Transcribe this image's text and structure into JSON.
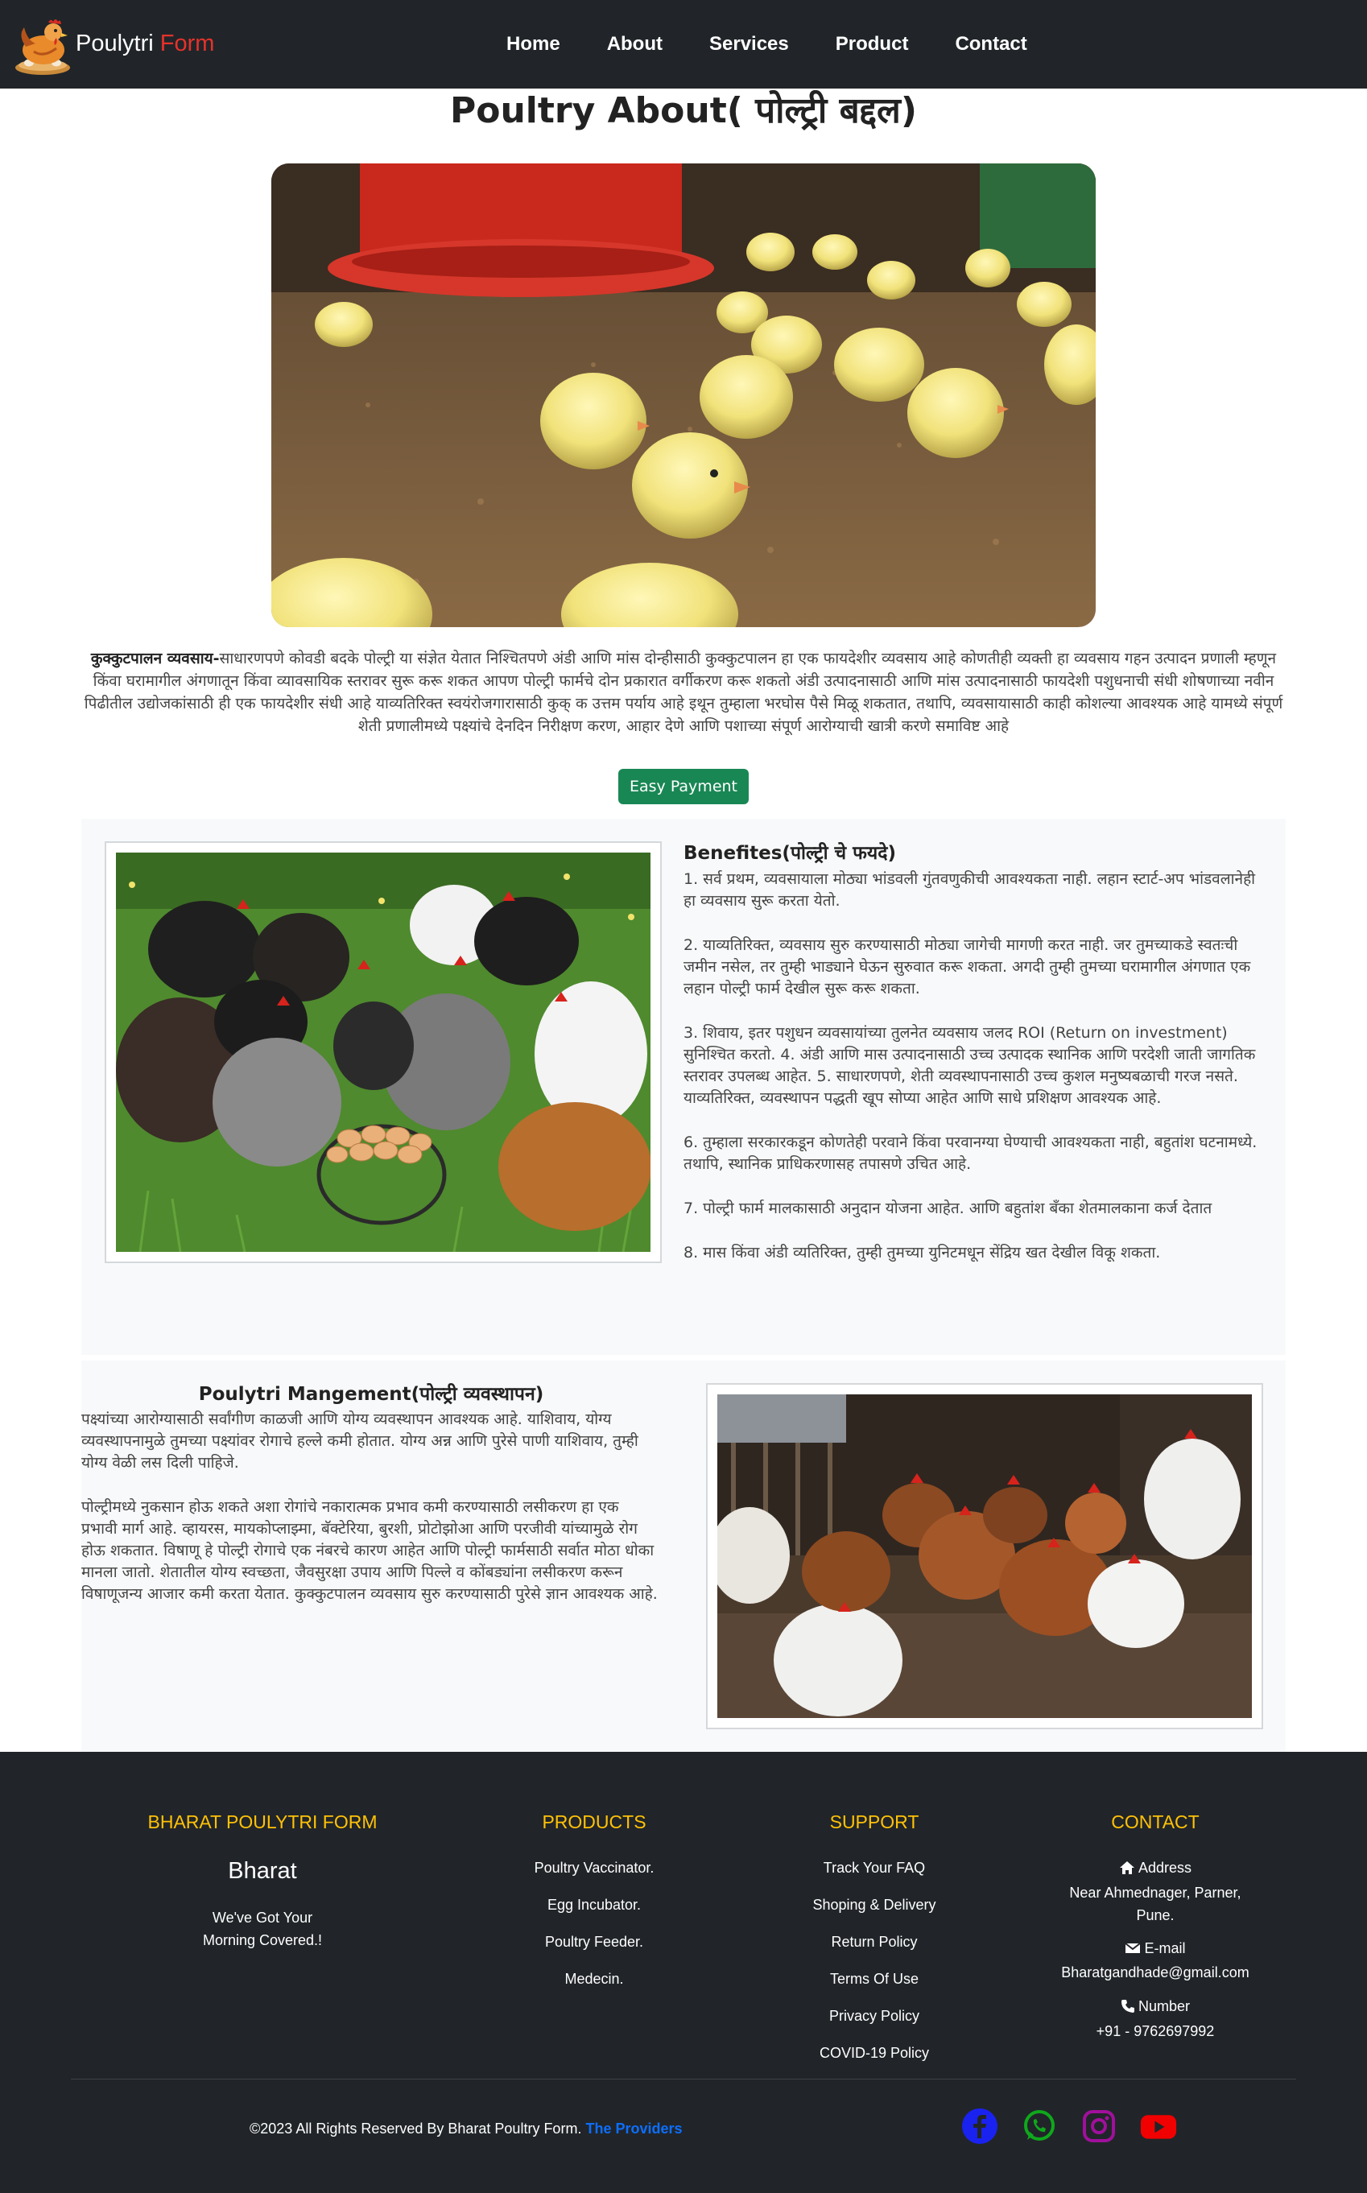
{
  "brand": {
    "name": "Poulytri",
    "accent": "Form"
  },
  "nav": {
    "items": [
      "Home",
      "About",
      "Services",
      "Product",
      "Contact"
    ]
  },
  "about": {
    "title": "Poultry About( पोल्ट्री बद्दल)",
    "lead": "कुक्कुटपालन व्यवसाय-",
    "text": "साधारणपणे कोवडी बदके पोल्ट्री या संज्ञेत येतात निश्चितपणे अंडी आणि मांस दोन्हीसाठी कुक्कुटपालन हा एक फायदेशीर व्यवसाय आहे कोणतीही व्यक्ती हा व्यवसाय गहन उत्पादन प्रणाली म्हणून किंवा घरामागील अंगणातून किंवा व्यावसायिक स्तरावर सुरू करू शकत आपण पोल्ट्री फार्मचे दोन प्रकारात वर्गीकरण करू शकतो अंडी उत्पादनासाठी आणि मांस उत्पादनासाठी फायदेशी पशुधनाची संधी शोषणाच्या नवीन पिढीतील उद्योजकांसाठी ही एक फायदेशीर संधी आहे याव्यतिरिक्त स्वयंरोजगारासाठी कुक्‌ क उत्तम पर्याय आहे इथून तुम्हाला भरघोस पैसे मिळू शकतात, तथापि, व्यवसायासाठी काही कोशल्या आवश्यक आहे यामध्ये संपूर्ण शेती प्रणालीमध्ये पक्ष्यांचे देनदिन निरीक्षण करण, आहार देणे आणि पशाच्या संपूर्ण आरोग्याची खात्री करणे समाविष्ट आहे",
    "pay_button": "Easy Payment"
  },
  "benefits": {
    "title": "Benefites(पोल्ट्री चे फयदे)",
    "items": [
      "1. सर्व प्रथम, व्यवसायाला मोठ्या भांडवली गुंतवणुकीची आवश्यकता नाही. लहान स्टार्ट-अप भांडवलानेही हा व्यवसाय सुरू करता येतो.",
      "2. याव्यतिरिक्त, व्यवसाय सुरु करण्यासाठी मोठ्या जागेची मागणी करत नाही. जर तुमच्याकडे स्वतःची जमीन नसेल, तर तुम्ही भाड्याने घेऊन सुरुवात करू शकता. अगदी तुम्ही तुमच्या घरामागील अंगणात एक लहान पोल्ट्री फार्म देखील सुरू करू शकता.",
      "3. शिवाय, इतर पशुधन व्यवसायांच्या तुलनेत व्यवसाय जलद ROI (Return on investment) सुनिश्चित करतो. 4. अंडी आणि मास उत्पादनासाठी उच्च उत्पादक स्थानिक आणि परदेशी जाती जागतिक स्तरावर उपलब्ध आहेत. 5. साधारणपणे, शेती व्यवस्थापनासाठी उच्च कुशल मनुष्यबळाची गरज नसते. याव्यतिरिक्त, व्यवस्थापन पद्धती खूप सोप्या आहेत आणि साधे प्रशिक्षण आवश्यक आहे.",
      "6. तुम्हाला सरकारकडून कोणतेही परवाने किंवा परवानग्या घेण्याची आवश्यकता नाही, बहुतांश घटनामध्ये. तथापि, स्थानिक प्राधिकरणासह तपासणे उचित आहे.",
      "7. पोल्ट्री फार्म मालकासाठी अनुदान योजना आहेत. आणि बहुतांश बँका शेतमालकाना कर्ज देतात",
      "8. मास किंवा अंडी व्यतिरिक्त, तुम्ही तुमच्या युनिटमधून सेंद्रिय खत देखील विकू शकता."
    ]
  },
  "management": {
    "title": "Poulytri Mangement(पोल्ट्री व्यवस्थापन)",
    "paragraphs": [
      "पक्ष्यांच्या आरोग्यासाठी सर्वांगीण काळजी आणि योग्य व्यवस्थापन आवश्यक आहे. याशिवाय, योग्य व्यवस्थापनामुळे तुमच्या पक्ष्यांवर रोगाचे हल्ले कमी होतात. योग्य अन्न आणि पुरेसे पाणी याशिवाय, तुम्ही योग्य वेळी लस दिली पाहिजे.",
      "पोल्ट्रीमध्ये नुकसान होऊ शकते अशा रोगांचे नकारात्मक प्रभाव कमी करण्यासाठी लसीकरण हा एक प्रभावी मार्ग आहे. व्हायरस, मायकोप्लाझ्मा, बॅक्टेरिया, बुरशी, प्रोटोझोआ आणि परजीवी यांच्यामुळे रोग होऊ शकतात. विषाणू हे पोल्ट्री रोगाचे एक नंबरचे कारण आहेत आणि पोल्ट्री फार्मसाठी सर्वात मोठा धोका मानला जातो. शेतातील योग्य स्वच्छता, जैवसुरक्षा उपाय आणि पिल्ले व कोंबड्यांना लसीकरण करून विषाणूजन्य आजार कमी करता येतात. कुक्कुटपालन व्यवसाय सुरु करण्यासाठी पुरेसे ज्ञान आवश्यक आहे."
    ]
  },
  "footer": {
    "about_col": {
      "heading": "BHARAT POULYTRI FORM",
      "name": "Bharat",
      "tagline_1": "We've Got Your",
      "tagline_2": "Morning Covered.!"
    },
    "products": {
      "heading": "PRODUCTS",
      "items": [
        "Poultry Vaccinator.",
        "Egg Incubator.",
        "Poultry Feeder.",
        "Medecin."
      ]
    },
    "support": {
      "heading": "SUPPORT",
      "items": [
        "Track Your FAQ",
        "Shoping & Delivery",
        "Return Policy",
        "Terms Of Use",
        "Privacy Policy",
        "COVID-19 Policy"
      ]
    },
    "contact": {
      "heading": "CONTACT",
      "address_label": "Address",
      "address_1": "Near Ahmednager, Parner,",
      "address_2": "Pune.",
      "email_label": "E-mail",
      "email": "Bharatgandhade@gmail.com",
      "phone_label": "Number",
      "phone": "+91 - 9762697992"
    },
    "copyright": "©2023 All Rights Reserved By Bharat Poultry Form.",
    "providers_link": "The Providers",
    "socials": [
      "facebook-icon",
      "whatsapp-icon",
      "instagram-icon",
      "youtube-icon"
    ]
  },
  "colors": {
    "nav_bg": "#212529",
    "accent_red": "#e5322b",
    "pay_green": "#198754",
    "footer_heading": "#ffc107",
    "link_blue": "#0d6efd"
  }
}
